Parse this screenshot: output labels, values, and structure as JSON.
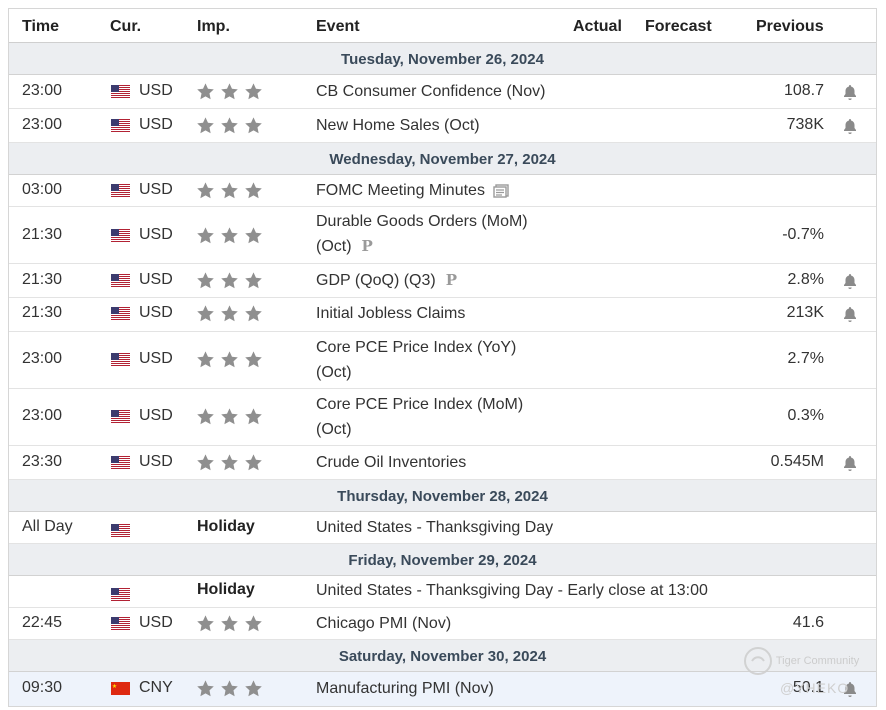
{
  "header": {
    "time": "Time",
    "cur": "Cur.",
    "imp": "Imp.",
    "event": "Event",
    "actual": "Actual",
    "forecast": "Forecast",
    "previous": "Previous"
  },
  "colors": {
    "flag_us_red": "#b22234",
    "flag_us_blue": "#3c3b6e",
    "flag_cn_red": "#de2910",
    "star_gray": "#8f8f8f",
    "date_bg": "#eceef1"
  },
  "days": [
    {
      "date": "Tuesday, November 26, 2024"
    },
    {
      "date": "Wednesday, November 27, 2024"
    },
    {
      "date": "Thursday, November 28, 2024"
    },
    {
      "date": "Friday, November 29, 2024"
    },
    {
      "date": "Saturday, November 30, 2024"
    }
  ],
  "events": [
    {
      "time": "23:00",
      "currency": "USD",
      "flag": "us-flag-icon",
      "event": "CB Consumer Confidence (Nov)",
      "previous": "108.7",
      "alert": true
    },
    {
      "time": "23:00",
      "currency": "USD",
      "flag": "us-flag-icon",
      "event": "New Home Sales (Oct)",
      "previous": "738K",
      "alert": true
    },
    {
      "time": "03:00",
      "currency": "USD",
      "flag": "us-flag-icon",
      "event": "FOMC Meeting Minutes",
      "previous": "",
      "alert": false,
      "doc_icon": true
    },
    {
      "time": "21:30",
      "currency": "USD",
      "flag": "us-flag-icon",
      "event_line1": "Durable Goods Orders (MoM)",
      "event_line2": "(Oct)",
      "previous": "-0.7%",
      "alert": false,
      "prelim": "P"
    },
    {
      "time": "21:30",
      "currency": "USD",
      "flag": "us-flag-icon",
      "event": "GDP (QoQ) (Q3)",
      "previous": "2.8%",
      "alert": true,
      "prelim": "P"
    },
    {
      "time": "21:30",
      "currency": "USD",
      "flag": "us-flag-icon",
      "event": "Initial Jobless Claims",
      "previous": "213K",
      "alert": true
    },
    {
      "time": "23:00",
      "currency": "USD",
      "flag": "us-flag-icon",
      "event_line1": "Core PCE Price Index (YoY)",
      "event_line2": "(Oct)",
      "previous": "2.7%",
      "alert": false
    },
    {
      "time": "23:00",
      "currency": "USD",
      "flag": "us-flag-icon",
      "event_line1": "Core PCE Price Index (MoM)",
      "event_line2": "(Oct)",
      "previous": "0.3%",
      "alert": false
    },
    {
      "time": "23:30",
      "currency": "USD",
      "flag": "us-flag-icon",
      "event": "Crude Oil Inventories",
      "previous": "0.545M",
      "alert": true
    },
    {
      "time": "All Day",
      "currency": "",
      "flag": "us-flag-icon",
      "holiday": "Holiday",
      "event": "United States - Thanksgiving Day"
    },
    {
      "time": "",
      "currency": "",
      "flag": "us-flag-icon",
      "holiday": "Holiday",
      "event": "United States - Thanksgiving Day - Early close at 13:00"
    },
    {
      "time": "22:45",
      "currency": "USD",
      "flag": "us-flag-icon",
      "event": "Chicago PMI (Nov)",
      "previous": "41.6",
      "alert": false
    },
    {
      "time": "09:30",
      "currency": "CNY",
      "flag": "cn-flag-icon",
      "event": "Manufacturing PMI (Nov)",
      "previous": "50.1",
      "alert": true
    }
  ],
  "watermark": {
    "brand": "Tiger Community",
    "user": "@YHEKO"
  }
}
